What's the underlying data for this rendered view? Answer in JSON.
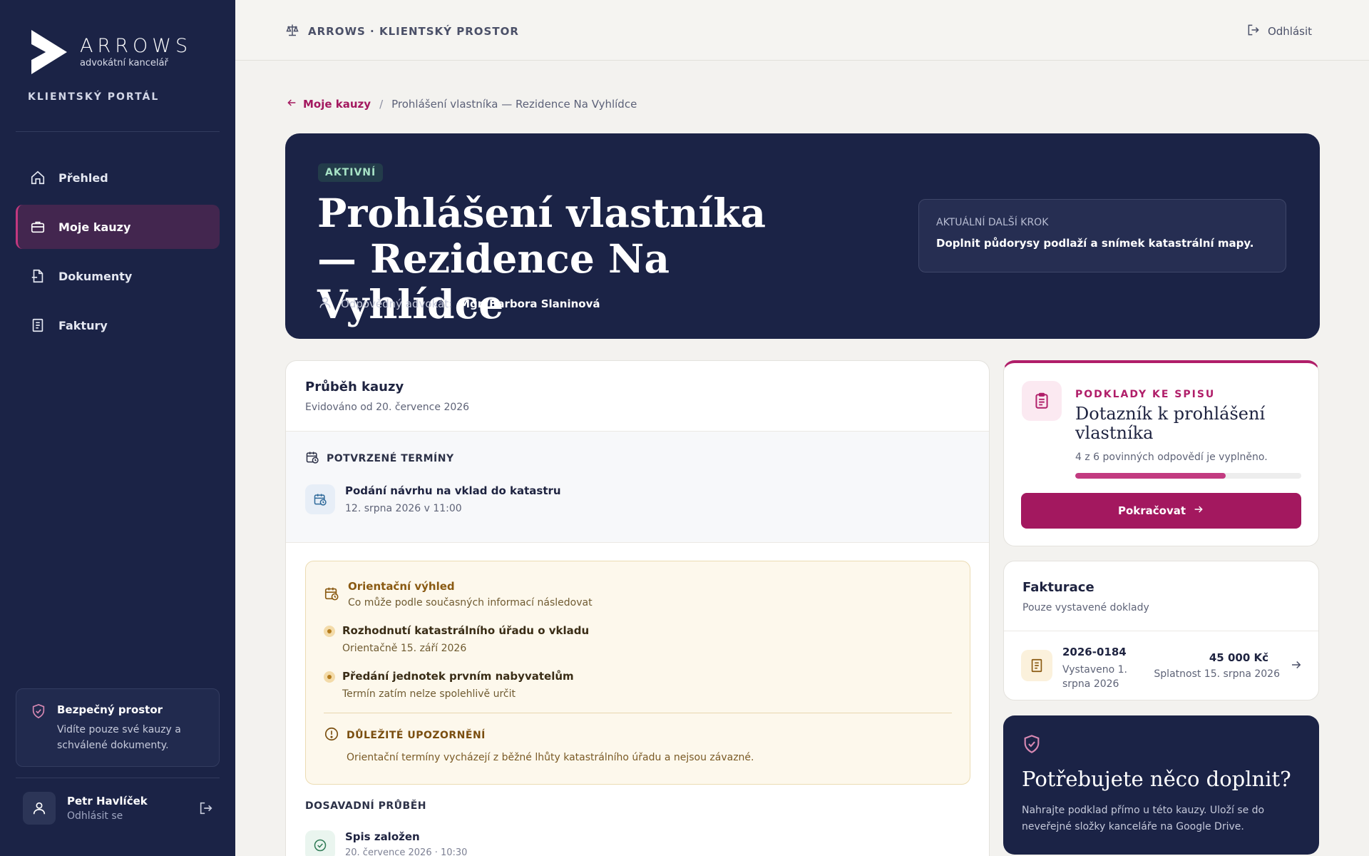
{
  "sidebar": {
    "brand_name": "ARROWS",
    "brand_sub": "advokátní kancelář",
    "portal_label": "KLIENTSKÝ PORTÁL",
    "nav": [
      {
        "label": "Přehled",
        "icon": "home-icon"
      },
      {
        "label": "Moje kauzy",
        "icon": "briefcase-icon",
        "active": true
      },
      {
        "label": "Dokumenty",
        "icon": "document-icon"
      },
      {
        "label": "Faktury",
        "icon": "invoice-icon"
      }
    ],
    "secure": {
      "title": "Bezpečný prostor",
      "text": "Vidíte pouze své kauzy a schválené dokumenty."
    },
    "user": {
      "name": "Petr Havlíček",
      "logout_label": "Odhlásit se"
    }
  },
  "topbar": {
    "title": "ARROWS · KLIENTSKÝ PROSTOR",
    "logout_label": "Odhlásit"
  },
  "breadcrumb": {
    "back_label": "Moje kauzy",
    "separator": "/",
    "current": "Prohlášení vlastníka — Rezidence Na Vyhlídce"
  },
  "hero": {
    "status": "AKTIVNÍ",
    "title": "Prohlášení vlastníka — Rezidence Na Vyhlídce",
    "lawyer_label": "Odpovědný advokát:",
    "lawyer_name": "Mgr. Barbora Slaninová",
    "next_step_label": "AKTUÁLNÍ DALŠÍ KROK",
    "next_step_text": "Doplnit půdorysy podlaží a snímek katastrální mapy."
  },
  "progress": {
    "title": "Průběh kauzy",
    "subtitle": "Evidováno od 20. července 2026",
    "confirmed_label": "POTVRZENÉ TERMÍNY",
    "confirmed": [
      {
        "title": "Podání návrhu na vklad do katastru",
        "date": "12. srpna 2026 v 11:00"
      }
    ],
    "outlook": {
      "title": "Orientační výhled",
      "subtitle": "Co může podle současných informací následovat",
      "items": [
        {
          "title": "Rozhodnutí katastrálního úřadu o vkladu",
          "sub": "Orientačně 15. září 2026"
        },
        {
          "title": "Předání jednotek prvním nabyvatelům",
          "sub": "Termín zatím nelze spolehlivě určit"
        }
      ],
      "warning_title": "DŮLEŽITÉ UPOZORNĚNÍ",
      "warning_text": "Orientační termíny vycházejí z běžné lhůty katastrálního úřadu a nejsou závazné."
    },
    "history_label": "DOSAVADNÍ PRŮBĚH",
    "history": [
      {
        "title": "Spis založen",
        "date": "20. července 2026 · 10:30"
      }
    ]
  },
  "questionnaire": {
    "kicker": "PODKLADY KE SPISU",
    "title": "Dotazník k prohlášení vlastníka",
    "progress_text": "4 z 6 povinných odpovědí je vyplněno.",
    "progress_fraction": 0.667,
    "button_label": "Pokračovat"
  },
  "invoices": {
    "title": "Fakturace",
    "subtitle": "Pouze vystavené doklady",
    "items": [
      {
        "number": "2026-0184",
        "issued": "Vystaveno 1. srpna 2026",
        "amount": "45 000 Kč",
        "due": "Splatnost 15. srpna 2026"
      }
    ]
  },
  "help": {
    "title": "Potřebujete něco doplnit?",
    "text": "Nahrajte podklad přímo u této kauzy. Uloží se do neveřejné složky kanceláře na Google Drive."
  },
  "colors": {
    "navy": "#1b2346",
    "accent": "#a3185f",
    "amber": "#8a5a12"
  }
}
